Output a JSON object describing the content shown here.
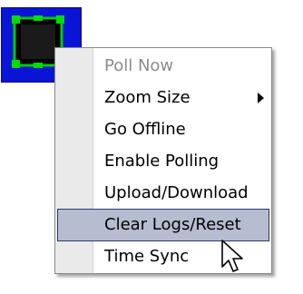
{
  "device": {
    "icon": "device-icon",
    "tile_color": "#0a14d6",
    "accent_color": "#00cc00"
  },
  "context_menu": {
    "items": [
      {
        "label": "Poll Now",
        "enabled": false
      },
      {
        "label": "Zoom Size",
        "has_submenu": true
      },
      {
        "label": "Go Offline"
      },
      {
        "label": "Enable Polling"
      },
      {
        "label": "Upload/Download"
      },
      {
        "label": "Clear Logs/Reset",
        "highlighted": true
      },
      {
        "label": "Time Sync"
      }
    ],
    "highlight_color": "#b6bdd0"
  },
  "cursor": {
    "icon": "pointer-cursor-icon"
  }
}
